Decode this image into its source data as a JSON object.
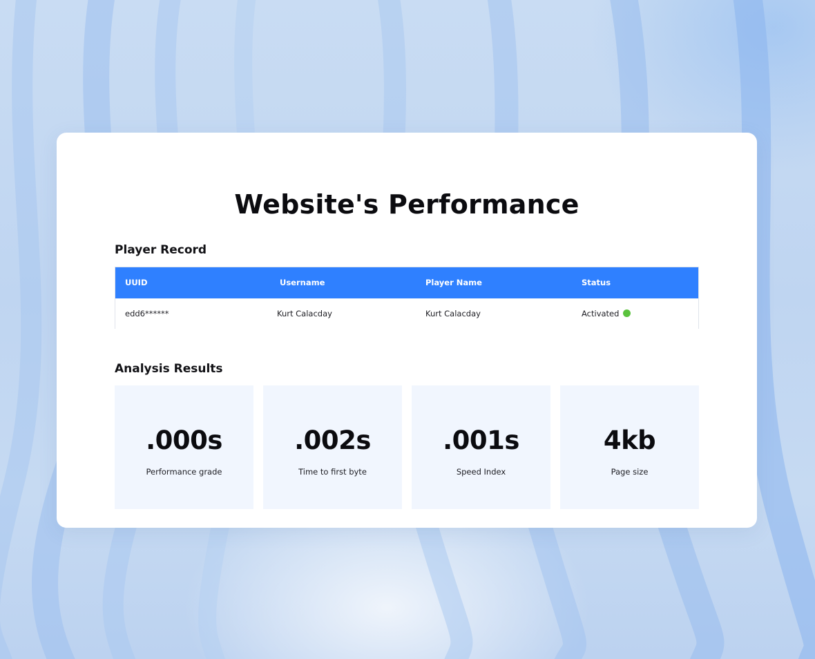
{
  "page": {
    "title": "Website's Performance"
  },
  "player_record": {
    "heading": "Player Record",
    "columns": [
      "UUID",
      "Username",
      "Player Name",
      "Status"
    ],
    "rows": [
      {
        "uuid": "edd6******",
        "username": "Kurt Calacday",
        "player_name": "Kurt Calacday",
        "status": "Activated",
        "status_color": "#5ac23d"
      }
    ],
    "header_color": "#2f80ff"
  },
  "analysis": {
    "heading": "Analysis Results",
    "metrics": [
      {
        "value": ".000s",
        "label": "Performance grade"
      },
      {
        "value": ".002s",
        "label": "Time to first byte"
      },
      {
        "value": ".001s",
        "label": "Speed Index"
      },
      {
        "value": "4kb",
        "label": "Page size"
      }
    ],
    "tile_color": "#f1f6fe"
  },
  "icons": {
    "status_indicator": "status-dot-icon"
  }
}
